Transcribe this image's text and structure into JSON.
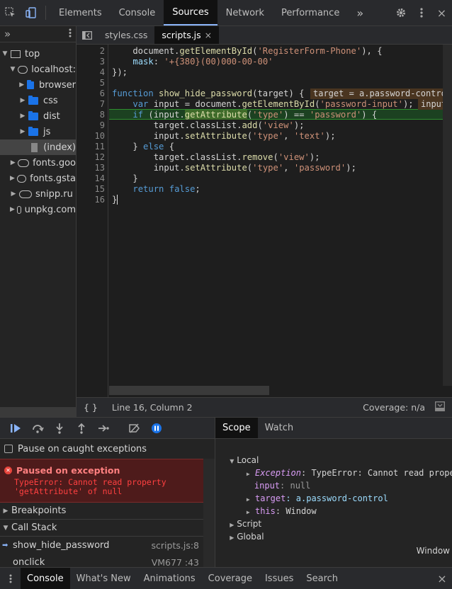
{
  "toolbar": {
    "tabs": [
      "Elements",
      "Console",
      "Sources",
      "Network",
      "Performance"
    ],
    "more": "»"
  },
  "navigator": {
    "more": "»",
    "items": [
      "top",
      "localhost:",
      "browser",
      "css",
      "dist",
      "js",
      "(index)",
      "fonts.goo",
      "fonts.gsta",
      "snipp.ru",
      "unpkg.com"
    ]
  },
  "editor": {
    "tabs": [
      "styles.css",
      "scripts.js"
    ],
    "close": "×",
    "line_numbers": [
      "2",
      "3",
      "4",
      "5",
      "6",
      "7",
      "8",
      "9",
      "10",
      "11",
      "12",
      "13",
      "14",
      "15",
      "16"
    ],
    "inline_values": [
      "target = a.password-control",
      "input"
    ]
  },
  "status": {
    "position": "Line 16, Column 2",
    "coverage": "Coverage: n/a",
    "braces": "{ }"
  },
  "debugger": {
    "pause_caught": "Pause on caught exceptions",
    "exception_title": "Paused on exception",
    "exception_msg": "TypeError: Cannot read property\n'getAttribute' of null",
    "breakpoints": "Breakpoints",
    "call_stack": "Call Stack",
    "frames": [
      {
        "name": "show_hide_password",
        "loc": "scripts.js:8"
      },
      {
        "name": "onclick",
        "loc": "VM677 :43"
      }
    ]
  },
  "scope": {
    "tabs": [
      "Scope",
      "Watch"
    ],
    "local": "Local",
    "exception_key": "Exception",
    "exception_val": ": TypeError: Cannot read propert…",
    "input_key": "input",
    "input_val": ": null",
    "target_key": "target",
    "target_val": ": a.password-control",
    "this_key": "this",
    "this_val": ": Window",
    "script": "Script",
    "global": "Global",
    "global_val": "Window"
  },
  "drawer": {
    "tabs": [
      "Console",
      "What's New",
      "Animations",
      "Coverage",
      "Issues",
      "Search"
    ],
    "close": "×"
  },
  "colors": {
    "accent": "#8ab4f8",
    "highlight_line": "#1c4121",
    "exception_bg": "#4e1b1b",
    "folder": "#1a73e8"
  }
}
